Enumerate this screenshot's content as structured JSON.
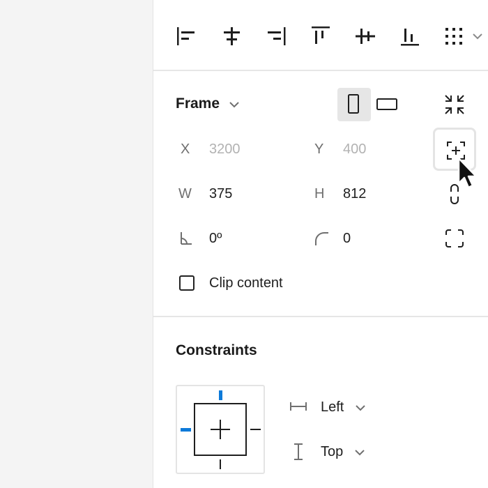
{
  "frame": {
    "title": "Frame",
    "x_label": "X",
    "x_value": "3200",
    "y_label": "Y",
    "y_value": "400",
    "w_label": "W",
    "w_value": "375",
    "h_label": "H",
    "h_value": "812",
    "rotation_value": "0º",
    "radius_value": "0",
    "clip_content_label": "Clip content",
    "clip_content_checked": false,
    "orientation_selected": "portrait"
  },
  "constraints": {
    "title": "Constraints",
    "horizontal_value": "Left",
    "vertical_value": "Top",
    "accent_color": "#0d7ad9"
  },
  "icons": {
    "align_left": "align-left-icon",
    "align_h_center": "align-horizontal-center-icon",
    "align_right": "align-right-icon",
    "align_top": "align-top-icon",
    "align_v_center": "align-vertical-center-icon",
    "align_bottom": "align-bottom-icon",
    "more": "grid-dots-icon",
    "resize_to_fit": "collapse-icon",
    "add_frame": "frame-plus-icon",
    "constrain_proportions": "link-icon",
    "independent_corners": "corners-icon"
  }
}
